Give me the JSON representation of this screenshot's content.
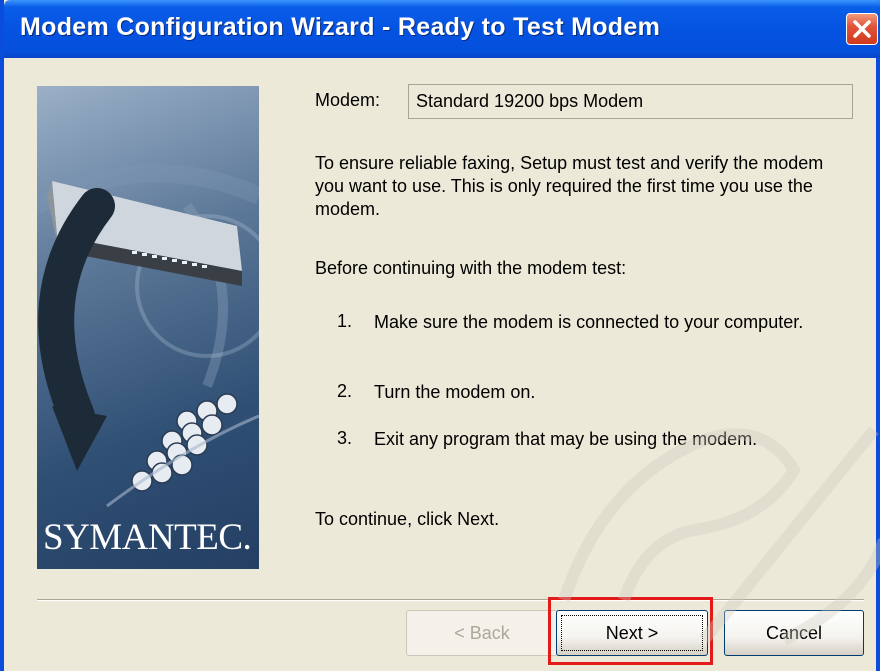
{
  "window": {
    "title": "Modem Configuration Wizard - Ready to Test Modem"
  },
  "titlebar_icons": {
    "close": "close-icon"
  },
  "side_panel": {
    "brand": "SYMANTEC."
  },
  "modem": {
    "label": "Modem:",
    "value": "Standard 19200 bps Modem"
  },
  "content": {
    "intro": "To ensure reliable faxing, Setup must test and verify the modem you want to use. This is only required the first time you use the modem.",
    "before": "Before continuing with the modem test:",
    "steps": [
      {
        "num": "1.",
        "text": "Make sure the modem is connected to your computer."
      },
      {
        "num": "2.",
        "text": "Turn the modem on."
      },
      {
        "num": "3.",
        "text": "Exit any program that may be using the modem."
      }
    ],
    "continue_text": "To continue, click Next."
  },
  "buttons": {
    "back": "< Back",
    "next": "Next >",
    "cancel": "Cancel"
  },
  "colors": {
    "titlebar": "#0553e1",
    "dialog_bg": "#ece9d8",
    "highlight": "#e21a1a"
  }
}
